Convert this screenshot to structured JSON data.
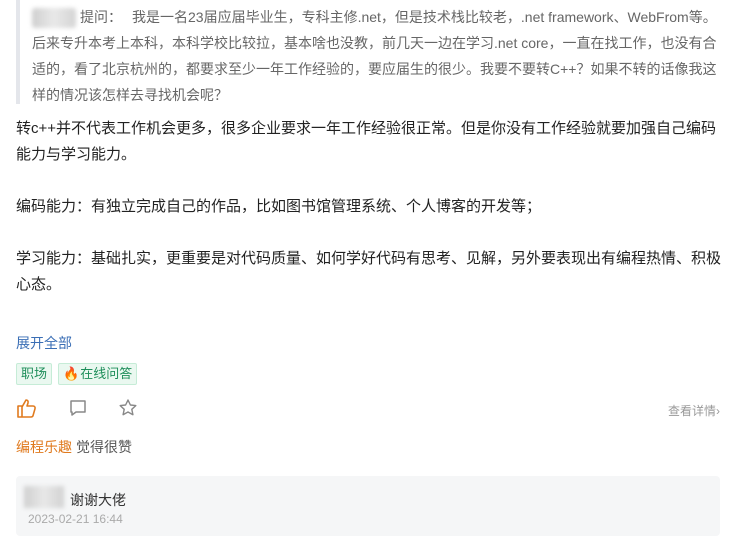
{
  "question": {
    "label": "提问：",
    "text": "我是一名23届应届毕业生，专科主修.net，但是技术栈比较老，.net framework、WebFrom等。后来专升本考上本科，本科学校比较拉，基本啥也没教，前几天一边在学习.net core，一直在找工作，也没有合适的，看了北京杭州的，都要求至少一年工作经验的，要应届生的很少。我要不要转C++？如果不转的话像我这样的情况该怎样去寻找机会呢？"
  },
  "answer": {
    "p1": "转c++并不代表工作机会更多，很多企业要求一年工作经验很正常。但是你没有工作经验就要加强自己编码能力与学习能力。",
    "p2": "编码能力：有独立完成自己的作品，比如图书馆管理系统、个人博客的开发等；",
    "p3": "学习能力：基础扎实，更重要是对代码质量、如何学好代码有思考、见解，另外要表现出有编程热情、积极心态。"
  },
  "expand_label": "展开全部",
  "tags": [
    "职场",
    "在线问答"
  ],
  "more_label": "查看详情",
  "more_chevron": "›",
  "likers": {
    "name": "编程乐趣",
    "suffix": "觉得很赞"
  },
  "comment": {
    "text": "谢谢大佬",
    "time": "2023-02-21 16:44"
  },
  "icons": [
    "thumbs-up-icon",
    "comment-icon",
    "star-icon",
    "chevron-right-icon",
    "fire-icon"
  ],
  "colors": {
    "accent_orange": "#e07a1e",
    "tag_green": "#1e8e5a",
    "link_blue": "#3a6eb5"
  }
}
